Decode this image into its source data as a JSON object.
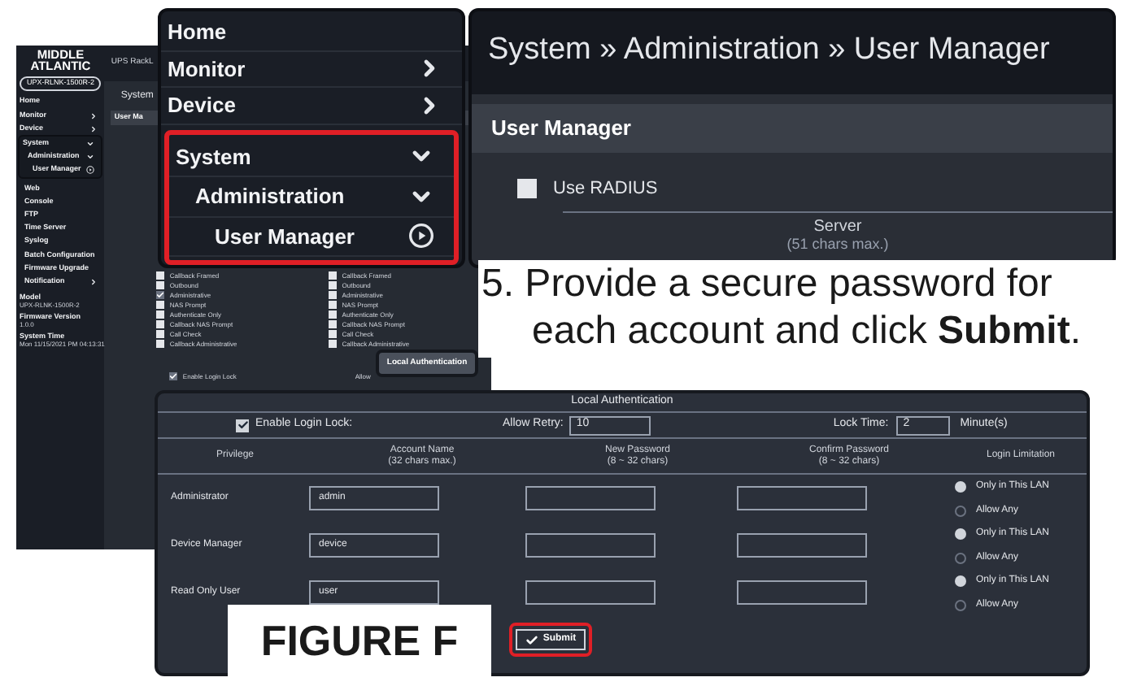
{
  "background_screen": {
    "logo": [
      "MIDDLE",
      "ATLANTIC"
    ],
    "model_pill": "UPX-RLNK-1500R-2",
    "header": "UPS RackL",
    "breadcrumb": "System",
    "tab": "User Ma",
    "sidebar": [
      {
        "label": "Home",
        "kind": "link"
      },
      {
        "label": "Monitor",
        "kind": "collapsed"
      },
      {
        "label": "Device",
        "kind": "collapsed"
      },
      {
        "label": "System",
        "kind": "expanded",
        "children": [
          {
            "label": "Administration",
            "kind": "expanded",
            "children": [
              {
                "label": "User Manager",
                "kind": "current"
              }
            ]
          },
          {
            "label": "Web",
            "kind": "link"
          },
          {
            "label": "Console",
            "kind": "link"
          },
          {
            "label": "FTP",
            "kind": "link"
          },
          {
            "label": "Time Server",
            "kind": "link"
          },
          {
            "label": "Syslog",
            "kind": "link"
          },
          {
            "label": "Batch Configuration",
            "kind": "link"
          },
          {
            "label": "Firmware Upgrade",
            "kind": "link"
          },
          {
            "label": "Notification",
            "kind": "collapsed"
          }
        ]
      }
    ],
    "info": [
      {
        "label": "Model",
        "value": "UPX-RLNK-1500R-2"
      },
      {
        "label": "Firmware Version",
        "value": "1.0.0"
      },
      {
        "label": "System Time",
        "value": "Mon 11/15/2021 PM 04:13:31"
      }
    ],
    "roles": [
      {
        "items": [
          {
            "label": "Callback Framed",
            "checked": false
          },
          {
            "label": "Outbound",
            "checked": false
          },
          {
            "label": "Administrative",
            "checked": true
          },
          {
            "label": "NAS Prompt",
            "checked": false
          },
          {
            "label": "Authenticate Only",
            "checked": false
          },
          {
            "label": "Callback NAS Prompt",
            "checked": false
          },
          {
            "label": "Call Check",
            "checked": false
          },
          {
            "label": "Callback Administrative",
            "checked": false
          }
        ]
      },
      {
        "items": [
          {
            "label": "Callback Framed",
            "checked": false
          },
          {
            "label": "Outbound",
            "checked": false
          },
          {
            "label": "Administrative",
            "checked": false
          },
          {
            "label": "NAS Prompt",
            "checked": false
          },
          {
            "label": "Authenticate Only",
            "checked": false
          },
          {
            "label": "Callback NAS Prompt",
            "checked": false
          },
          {
            "label": "Call Check",
            "checked": false
          },
          {
            "label": "Callback Administrative",
            "checked": false
          }
        ]
      }
    ],
    "local_auth_button": "Local Authentication",
    "enable_login_lock": {
      "label": "Enable Login Lock",
      "checked": true
    },
    "allow_label": "Allow"
  },
  "nav_zoom": {
    "items": [
      {
        "label": "Home",
        "kind": "link"
      },
      {
        "label": "Monitor",
        "kind": "collapsed"
      },
      {
        "label": "Device",
        "kind": "collapsed"
      },
      {
        "label": "System",
        "kind": "expanded",
        "children": [
          {
            "label": "Administration",
            "kind": "expanded",
            "children": [
              {
                "label": "User Manager",
                "kind": "current"
              }
            ]
          }
        ]
      }
    ]
  },
  "title_zoom": {
    "breadcrumb": "System » Administration » User Manager",
    "section_title": "User Manager",
    "use_radius": {
      "label": "Use RADIUS",
      "checked": false
    },
    "server_header": "Server",
    "server_hint": "(51 chars max.)"
  },
  "instruction": "5. Provide a secure password for each account and click **Submit**.",
  "local_auth": {
    "title": "Local Authentication",
    "enable_login_lock": {
      "label": "Enable Login Lock:",
      "checked": true
    },
    "allow_retry": {
      "label": "Allow Retry:",
      "value": "10"
    },
    "lock_time": {
      "label": "Lock Time:",
      "value": "2",
      "unit": "Minute(s)"
    },
    "columns": [
      {
        "title": "Privilege"
      },
      {
        "title": "Account Name",
        "hint": "(32 chars max.)"
      },
      {
        "title": "New Password",
        "hint": "(8 ~ 32 chars)"
      },
      {
        "title": "Confirm Password",
        "hint": "(8 ~ 32 chars)"
      },
      {
        "title": "Login Limitation"
      }
    ],
    "rows": [
      {
        "privilege": "Administrator",
        "account": "admin",
        "options": [
          {
            "label": "Only in This LAN",
            "selected": true
          },
          {
            "label": "Allow Any",
            "selected": false
          }
        ]
      },
      {
        "privilege": "Device Manager",
        "account": "device",
        "options": [
          {
            "label": "Only in This LAN",
            "selected": true
          },
          {
            "label": "Allow Any",
            "selected": false
          }
        ]
      },
      {
        "privilege": "Read Only User",
        "account": "user",
        "options": [
          {
            "label": "Only in This LAN",
            "selected": true
          },
          {
            "label": "Allow Any",
            "selected": false
          }
        ]
      }
    ],
    "submit": "Submit"
  },
  "caption": "FIGURE F"
}
